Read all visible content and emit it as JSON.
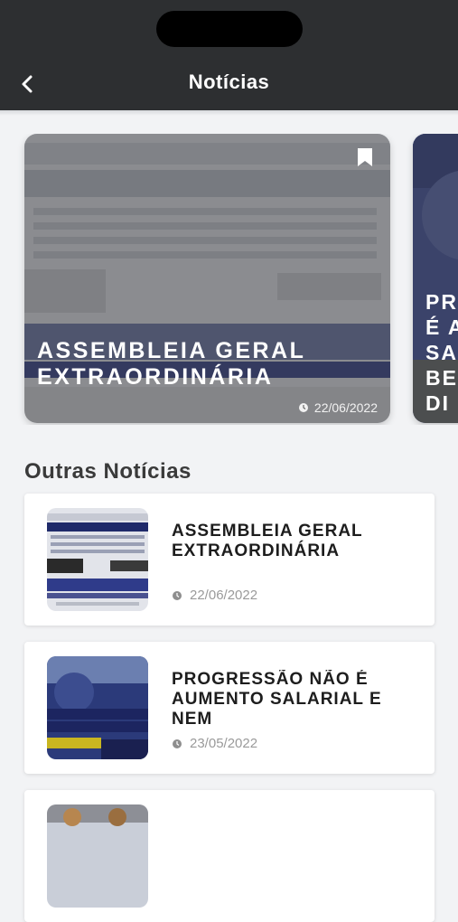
{
  "header": {
    "title": "Notícias",
    "back_icon": "chevron-left-icon"
  },
  "featured": [
    {
      "title": "ASSEMBLEIA GERAL EXTRAORDINÁRIA",
      "date": "22/06/2022",
      "bookmark_icon": "bookmark-icon"
    },
    {
      "title_partial": "PR\nÉ A\nSA\nBE\nDI"
    }
  ],
  "section": {
    "title": "Outras Notícias"
  },
  "news": [
    {
      "title": "ASSEMBLEIA GERAL EXTRAORDINÁRIA",
      "date": "22/06/2022"
    },
    {
      "title": "PROGRESSÃO NÃO É AUMENTO SALARIAL E NEM",
      "date": "23/05/2022"
    }
  ],
  "colors": {
    "header_bg": "#2d2f31",
    "page_bg": "#f2f3f5",
    "card_bg": "#ffffff"
  }
}
